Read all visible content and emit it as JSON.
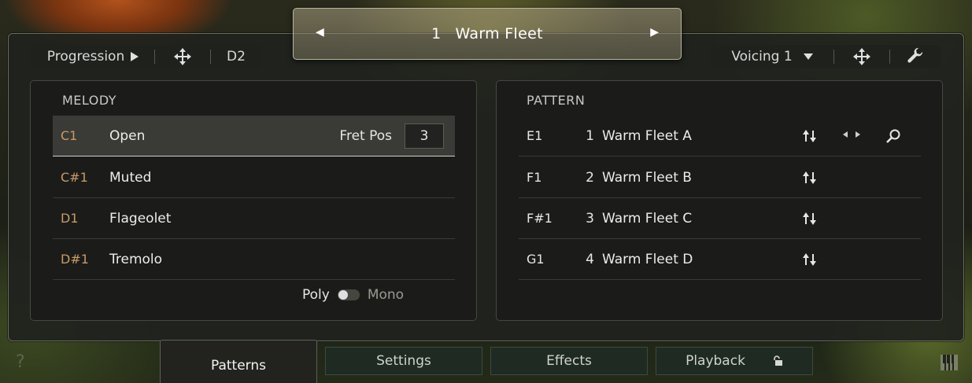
{
  "preset": {
    "number": "1",
    "name": "Warm Fleet"
  },
  "toolbar_left": {
    "progression_label": "Progression",
    "key_label": "D2"
  },
  "toolbar_right": {
    "voicing_label": "Voicing 1"
  },
  "melody": {
    "title": "MELODY",
    "rows": [
      {
        "note": "C1",
        "label": "Open"
      },
      {
        "note": "C#1",
        "label": "Muted"
      },
      {
        "note": "D1",
        "label": "Flageolet"
      },
      {
        "note": "D#1",
        "label": "Tremolo"
      }
    ],
    "fret_label": "Fret Pos",
    "fret_value": "3",
    "poly_label": "Poly",
    "mono_label": "Mono"
  },
  "pattern": {
    "title": "PATTERN",
    "rows": [
      {
        "note": "E1",
        "num": "1",
        "name": "Warm Fleet A"
      },
      {
        "note": "F1",
        "num": "2",
        "name": "Warm Fleet B"
      },
      {
        "note": "F#1",
        "num": "3",
        "name": "Warm Fleet C"
      },
      {
        "note": "G1",
        "num": "4",
        "name": "Warm Fleet D"
      }
    ]
  },
  "tabs": {
    "patterns": "Patterns",
    "settings": "Settings",
    "effects": "Effects",
    "playback": "Playback"
  },
  "help_label": "?",
  "icons": {
    "move": "move-icon",
    "wrench": "wrench-icon",
    "updown": "up-down-arrows-icon",
    "search": "search-icon",
    "lock": "lock-icon",
    "piano": "piano-keys-icon"
  }
}
